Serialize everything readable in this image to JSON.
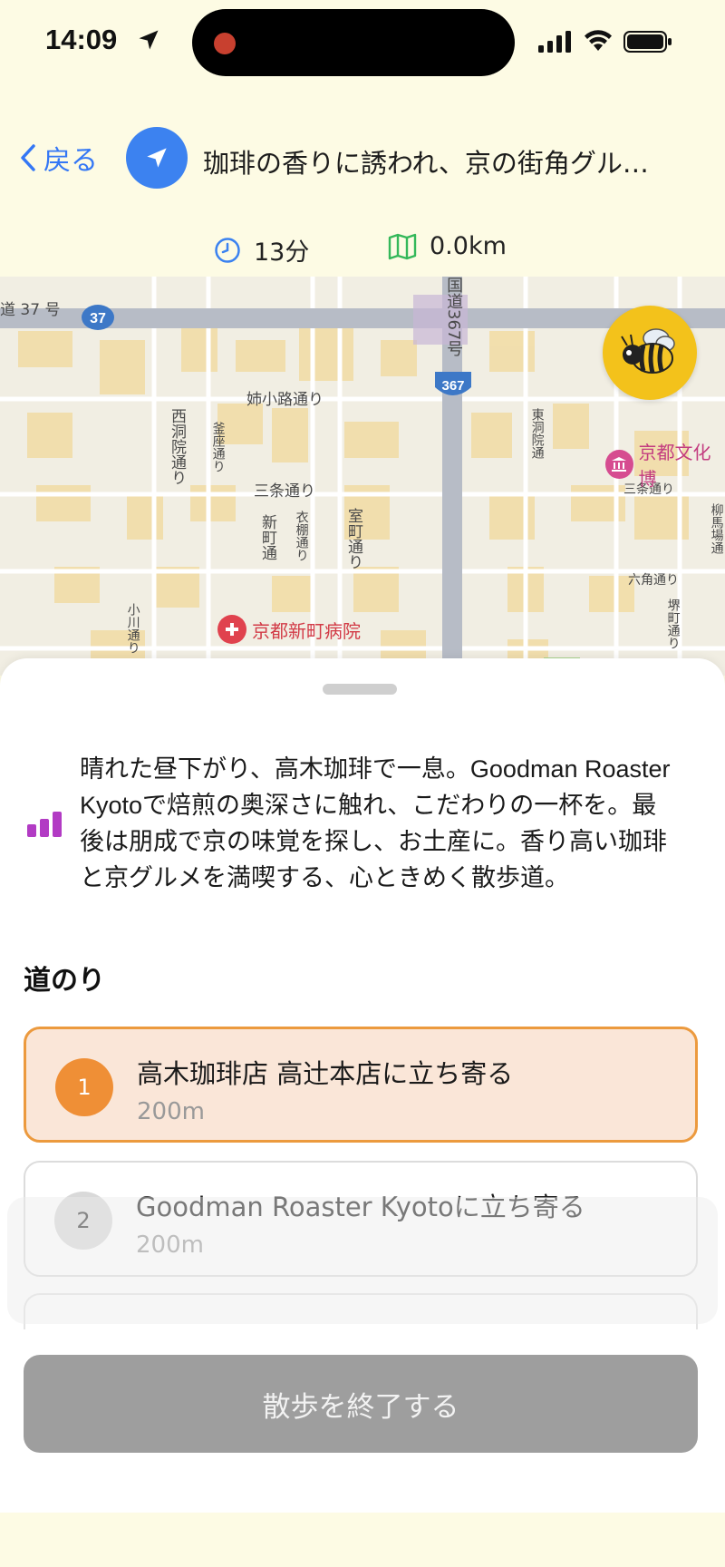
{
  "status": {
    "time": "14:09"
  },
  "header": {
    "back_label": "戻る",
    "title": "珈琲の香りに誘われ、京の街角グル…"
  },
  "stats": {
    "duration": "13分",
    "distance": "0.0km"
  },
  "map": {
    "labels": {
      "route37": "道 37 号",
      "shield37": "37",
      "kokudo": "国道367号",
      "shield367": "367",
      "anekoji": "姉小路通り",
      "nishinotoin": "西洞院通り",
      "kamanza": "釜座通り",
      "sanjo_left": "三条通り",
      "shinmachi": "新町通",
      "koromonotana": "衣棚通り",
      "muromachi": "室町通り",
      "higashinotoin": "東洞院通",
      "sanjo_right": "三条通り",
      "rokkaku": "六角通り",
      "sakaimachi": "堺町通り",
      "yanaginobanba": "柳馬場通",
      "ogawa": "小川通り"
    },
    "pois": {
      "museum": "京都文化博",
      "hospital": "京都新町病院"
    }
  },
  "sheet": {
    "description": "晴れた昼下がり、高木珈琲で一息。Goodman Roaster Kyotoで焙煎の奥深さに触れ、こだわりの一杯を。最後は朋成で京の味覚を探し、お土産に。香り高い珈琲と京グルメを満喫する、心ときめく散歩道。",
    "section_title": "道のり",
    "steps": [
      {
        "num": "1",
        "title": "高木珈琲店 高辻本店に立ち寄る",
        "distance": "200m"
      },
      {
        "num": "2",
        "title": "Goodman Roaster Kyotoに立ち寄る",
        "distance": "200m"
      }
    ],
    "end_button": "散歩を終了する"
  },
  "colors": {
    "background": "#fdfbe4",
    "accent_blue": "#3c82f0",
    "active_step_bg": "#fae6d8",
    "active_step_border": "#ec9a3e",
    "step_badge": "#ef8f36",
    "end_button": "#9e9e9e",
    "bars_icon": "#b23bc4"
  },
  "icons": {
    "location": "location-arrow-icon",
    "navigation": "navigation-arrow-icon",
    "clock": "clock-icon",
    "map": "map-icon",
    "bee": "bee-icon",
    "bars": "bar-chart-icon"
  }
}
